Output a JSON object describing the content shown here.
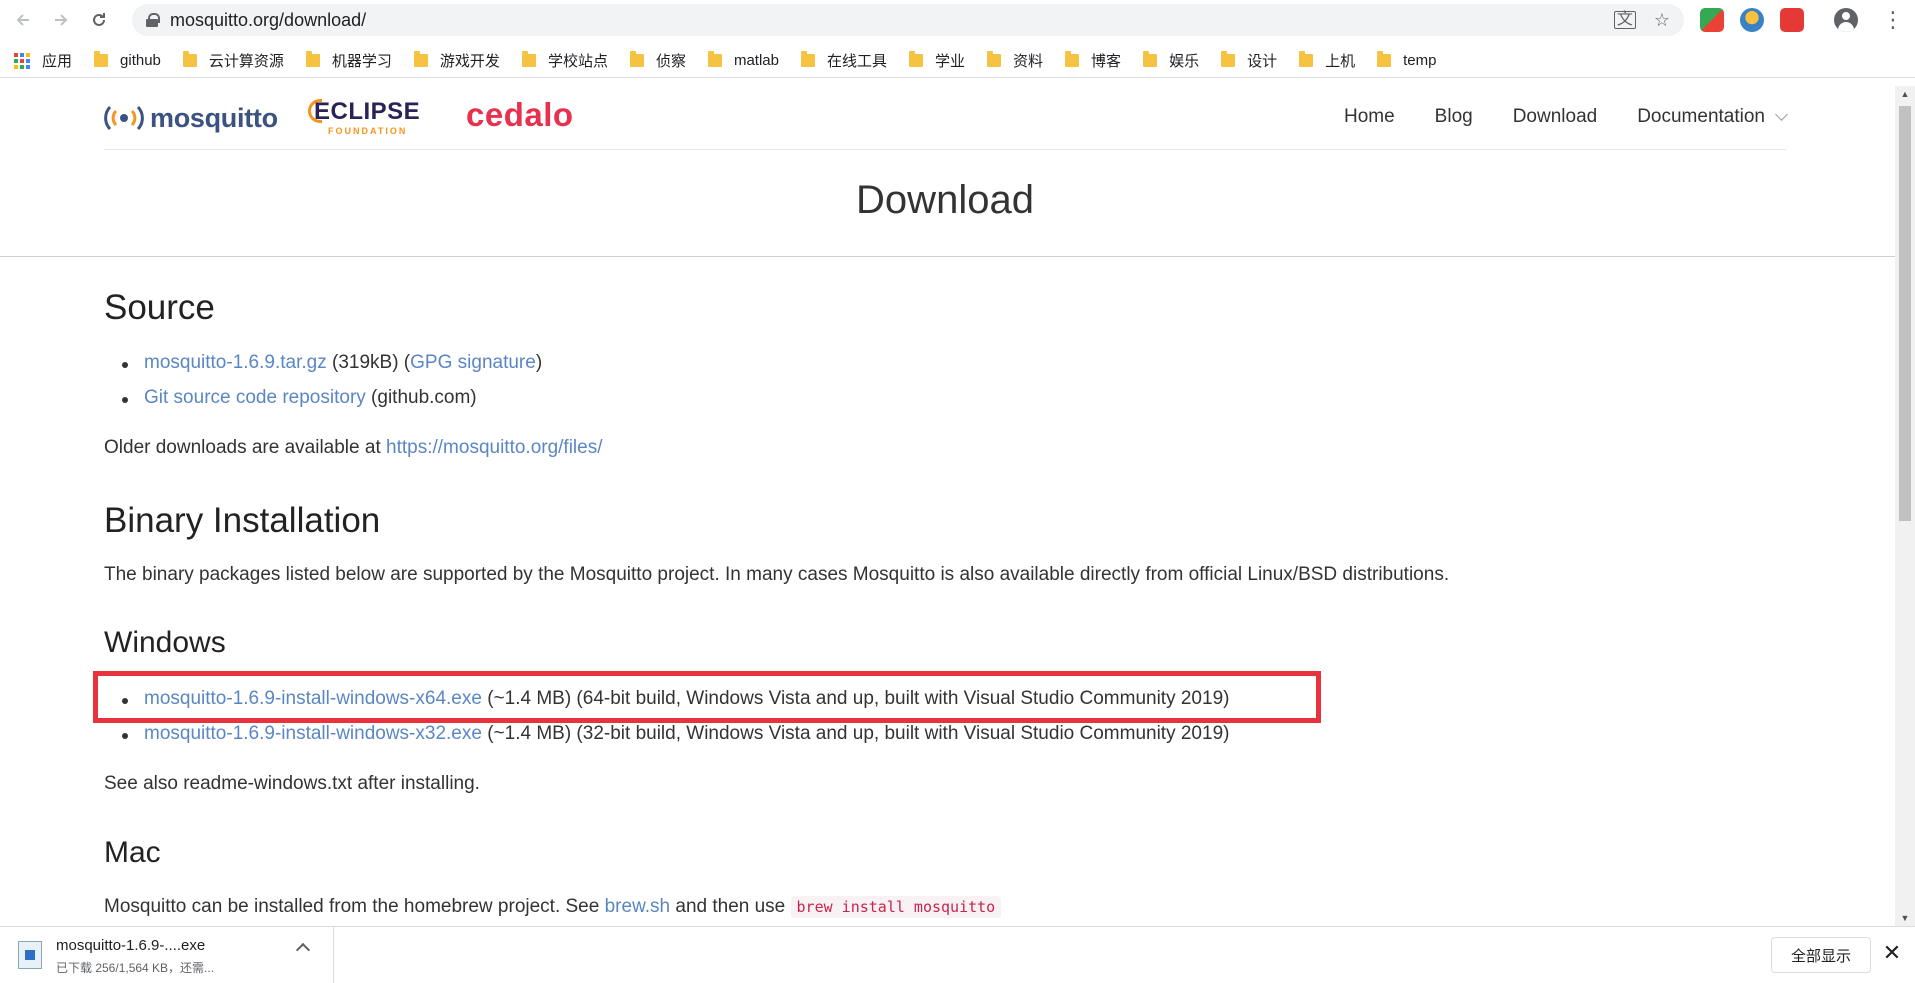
{
  "browser": {
    "back_icon": "arrow-left-icon",
    "forward_icon": "arrow-right-icon",
    "reload_icon": "reload-icon",
    "url": "mosquitto.org/download/",
    "bookmarks": [
      {
        "label": "应用",
        "icon": "apps-grid-icon"
      },
      {
        "label": "github",
        "icon": "folder-icon"
      },
      {
        "label": "云计算资源",
        "icon": "folder-icon"
      },
      {
        "label": "机器学习",
        "icon": "folder-icon"
      },
      {
        "label": "游戏开发",
        "icon": "folder-icon"
      },
      {
        "label": "学校站点",
        "icon": "folder-icon"
      },
      {
        "label": "侦察",
        "icon": "folder-icon"
      },
      {
        "label": "matlab",
        "icon": "folder-icon"
      },
      {
        "label": "在线工具",
        "icon": "folder-icon"
      },
      {
        "label": "学业",
        "icon": "folder-icon"
      },
      {
        "label": "资料",
        "icon": "folder-icon"
      },
      {
        "label": "博客",
        "icon": "folder-icon"
      },
      {
        "label": "娱乐",
        "icon": "folder-icon"
      },
      {
        "label": "设计",
        "icon": "folder-icon"
      },
      {
        "label": "上机",
        "icon": "folder-icon"
      },
      {
        "label": "temp",
        "icon": "folder-icon"
      }
    ]
  },
  "site": {
    "logo_mosquitto": "mosquitto",
    "logo_eclipse": "ECLIPSE",
    "logo_eclipse_sub": "FOUNDATION",
    "logo_cedalo": "cedalo",
    "nav": {
      "home": "Home",
      "blog": "Blog",
      "download": "Download",
      "documentation": "Documentation"
    }
  },
  "page": {
    "title": "Download",
    "source": {
      "heading": "Source",
      "tarball_link": "mosquitto-1.6.9.tar.gz",
      "tarball_size_prefix": " (319kB) (",
      "gpg_link": "GPG signature",
      "tarball_suffix": ")",
      "git_link": "Git source code repository",
      "git_suffix": " (github.com)",
      "older_text": "Older downloads are available at ",
      "older_link": "https://mosquitto.org/files/"
    },
    "binary": {
      "heading": "Binary Installation",
      "text": "The binary packages listed below are supported by the Mosquitto project. In many cases Mosquitto is also available directly from official Linux/BSD distributions."
    },
    "windows": {
      "heading": "Windows",
      "x64_link": "mosquitto-1.6.9-install-windows-x64.exe",
      "x64_desc": " (~1.4 MB) (64-bit build, Windows Vista and up, built with Visual Studio Community 2019)",
      "x32_link": "mosquitto-1.6.9-install-windows-x32.exe",
      "x32_desc": " (~1.4 MB) (32-bit build, Windows Vista and up, built with Visual Studio Community 2019)",
      "note": "See also readme-windows.txt after installing."
    },
    "mac": {
      "heading": "Mac",
      "text_before": "Mosquitto can be installed from the homebrew project. See ",
      "brew_link": "brew.sh",
      "text_mid": " and then use ",
      "code": "brew install mosquitto"
    }
  },
  "download_shelf": {
    "file_name": "mosquitto-1.6.9-....exe",
    "status": "已下载 256/1,564 KB，还需...",
    "show_all": "全部显示",
    "close_icon": "close-icon"
  },
  "colors": {
    "link": "#5b86c5",
    "highlight_border": "#e8323c",
    "cedalo": "#e8304f",
    "mosquitto_logo": "#3c5280",
    "eclipse_orange": "#f7941e"
  }
}
